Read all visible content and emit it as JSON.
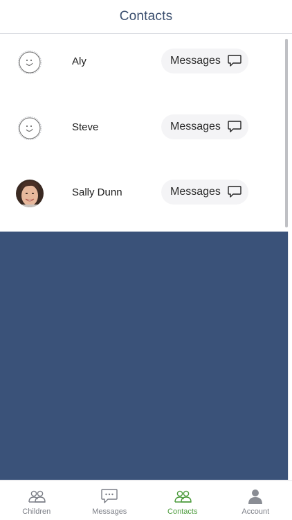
{
  "header": {
    "title": "Contacts"
  },
  "contacts": [
    {
      "name": "Aly",
      "action_label": "Messages",
      "avatar": "smiley-placeholder"
    },
    {
      "name": "Steve",
      "action_label": "Messages",
      "avatar": "smiley-placeholder"
    },
    {
      "name": "Sally Dunn",
      "action_label": "Messages",
      "avatar": "photo"
    }
  ],
  "tabs": [
    {
      "label": "Children",
      "icon": "people-icon",
      "active": false
    },
    {
      "label": "Messages",
      "icon": "chat-icon",
      "active": false
    },
    {
      "label": "Contacts",
      "icon": "contacts-icon",
      "active": true
    },
    {
      "label": "Account",
      "icon": "person-icon",
      "active": false
    }
  ],
  "colors": {
    "header_title": "#3a4e6e",
    "panel_blue": "#3a5279",
    "active_tab": "#4a9a3a",
    "inactive_tab": "#7a7d85"
  }
}
